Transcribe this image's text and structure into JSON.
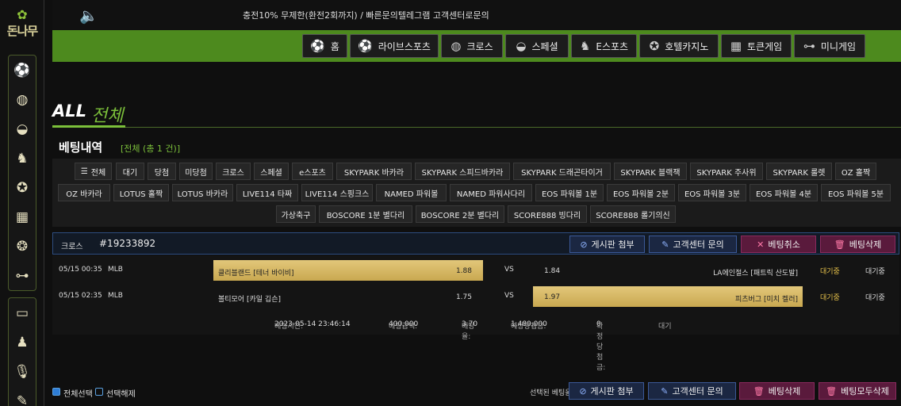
{
  "brand": {
    "logo_text": "돈나무",
    "tree_glyph": "✿"
  },
  "sidebar": {
    "icons": [
      "soccer-ball-icon",
      "basketball-icon",
      "tennis-ball-icon",
      "esports-icon",
      "casino-chip-icon",
      "slot-machine-icon",
      "poker-chip-icon",
      "gamepad-icon"
    ],
    "icons2": [
      "wallet-icon",
      "group-icon",
      "microphone-icon",
      "pencil-icon"
    ]
  },
  "topbar": {
    "notice": "충전10% 무제한(환전2회까지) / 빠른문의텔레그램 고객센터로문의"
  },
  "nav": [
    {
      "label": "홈",
      "icon": "soccer-ball-icon"
    },
    {
      "label": "라이브스포츠",
      "icon": "soccer-ball-icon"
    },
    {
      "label": "크로스",
      "icon": "basketball-icon"
    },
    {
      "label": "스페셜",
      "icon": "tennis-ball-icon"
    },
    {
      "label": "E스포츠",
      "icon": "esports-icon"
    },
    {
      "label": "호텔카지노",
      "icon": "casino-chip-icon"
    },
    {
      "label": "토큰게임",
      "icon": "slot-machine-icon"
    },
    {
      "label": "미니게임",
      "icon": "gamepad-icon"
    }
  ],
  "page": {
    "title_en": "ALL",
    "title_kr": "전체",
    "section": "베팅내역",
    "count": "[전체 (총 1 건)]"
  },
  "filters": [
    "전체",
    "대기",
    "당첨",
    "미당첨",
    "크로스",
    "스페셜",
    "e스포츠",
    "SKYPARK 바카라",
    "SKYPARK 스피드바카라",
    "SKYPARK 드래곤타이거",
    "SKYPARK 블랙잭",
    "SKYPARK 주사위",
    "SKYPARK 룰렛",
    "OZ 홀짝",
    "OZ 바카라",
    "LOTUS 홀짝",
    "LOTUS 바카라",
    "LIVE114 타짜",
    "LIVE114 스핑크스",
    "NAMED 파워볼",
    "NAMED 파워사다리",
    "EOS 파워볼 1분",
    "EOS 파워볼 2분",
    "EOS 파워볼 3분",
    "EOS 파워볼 4분",
    "EOS 파워볼 5분",
    "가상축구",
    "BOSCORE 1분 별다리",
    "BOSCORE 2분 별다리",
    "SCORE888 빙다리",
    "SCORE888 롤기의신"
  ],
  "bet": {
    "type": "크로스",
    "id": "#19233892",
    "actions": {
      "board": "게시판 첨부",
      "support": "고객센터 문의",
      "cancel": "베팅취소",
      "delete": "베팅삭제"
    },
    "rows": [
      {
        "time": "05/15 00:35",
        "league": "MLB",
        "home": "클리블랜드 [테너 바이비]",
        "home_odds": "1.88",
        "vs": "VS",
        "away_odds": "1.84",
        "away": "LA에인절스 [패트릭 산도발]",
        "status1": "대기중",
        "status2": "대기중",
        "selected": "home"
      },
      {
        "time": "05/15 02:35",
        "league": "MLB",
        "home": "볼티모어 [카일 깁슨]",
        "home_odds": "1.75",
        "vs": "VS",
        "away_odds": "1.97",
        "away": "피츠버그 [미치 켈러]",
        "status1": "대기중",
        "status2": "대기중",
        "selected": "away"
      }
    ],
    "summary": {
      "time_label": "베팅시간:",
      "time": "2023-05-14 23:46:14",
      "amount_label": "베팅금액:",
      "amount": "400,000",
      "rate_label": "배당율:",
      "rate": "3.70",
      "expected_label": "예상당첨금:",
      "expected": "1,480,000",
      "confirmed_label": "확정당첨금:",
      "confirmed": "0",
      "state": "대기"
    }
  },
  "bottom": {
    "select_all": "전체선택",
    "deselect": "선택해제",
    "selected_label": "선택된 베팅을",
    "board": "게시판 첨부",
    "support": "고객센터 문의",
    "delete": "베팅삭제",
    "delete_all": "베팅모두삭제"
  },
  "colors": {
    "nav_green": "#4d8a1e",
    "accent_green": "#7bbf3a",
    "gold": "#d4b460",
    "pink": "#ff7aa8",
    "blue": "#3b5998"
  }
}
